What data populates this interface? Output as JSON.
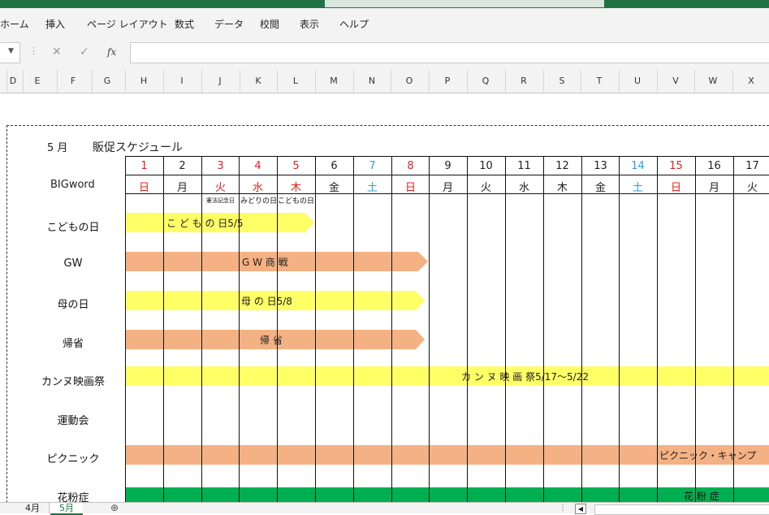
{
  "ribbon": {
    "tabs": [
      "ホーム",
      "挿入",
      "ページ レイアウト",
      "数式",
      "データ",
      "校閲",
      "表示",
      "ヘルプ"
    ]
  },
  "formula_bar": {
    "fx_label": "fx",
    "value": ""
  },
  "columns": [
    "D",
    "E",
    "F",
    "G",
    "H",
    "I",
    "J",
    "K",
    "L",
    "M",
    "N",
    "O",
    "P",
    "Q",
    "R",
    "S",
    "T",
    "U",
    "V",
    "W",
    "X"
  ],
  "sheet": {
    "month_label": "5 月",
    "title": "販促スケジュール",
    "bigword_label": "BIGword",
    "days": [
      "1",
      "2",
      "3",
      "4",
      "5",
      "6",
      "7",
      "8",
      "9",
      "10",
      "11",
      "12",
      "13",
      "14",
      "15",
      "16",
      "17"
    ],
    "weekdays": [
      "日",
      "月",
      "火",
      "水",
      "木",
      "金",
      "土",
      "日",
      "月",
      "火",
      "水",
      "木",
      "金",
      "土",
      "日",
      "月",
      "火"
    ],
    "day_colors": [
      "red",
      "black",
      "red",
      "red",
      "red",
      "black",
      "blue",
      "red",
      "black",
      "black",
      "black",
      "black",
      "black",
      "blue",
      "red",
      "black",
      "black"
    ],
    "holidays": [
      "憲法記念日",
      "みどりの日",
      "こどもの日"
    ],
    "rows": [
      {
        "label": "こどもの日",
        "bar_text": "こ ど も の 日5/5"
      },
      {
        "label": "GW",
        "bar_text": "G W 商 戦"
      },
      {
        "label": "母の日",
        "bar_text": "母 の 日5/8"
      },
      {
        "label": "帰省",
        "bar_text": "帰 省"
      },
      {
        "label": "カンヌ映画祭",
        "bar_text": "カ ン ヌ 映 画 祭5/17～5/22"
      },
      {
        "label": "運動会",
        "bar_text": ""
      },
      {
        "label": "ピクニック",
        "bar_text": "ピクニック・キャンプ"
      },
      {
        "label": "花粉症",
        "bar_text": "花 粉 症"
      }
    ],
    "colors": {
      "yellow": "#ffff66",
      "orange": "#f4b183",
      "green": "#00b050"
    }
  },
  "sheet_tabs": [
    "4月",
    "5月"
  ],
  "active_tab": "5月"
}
